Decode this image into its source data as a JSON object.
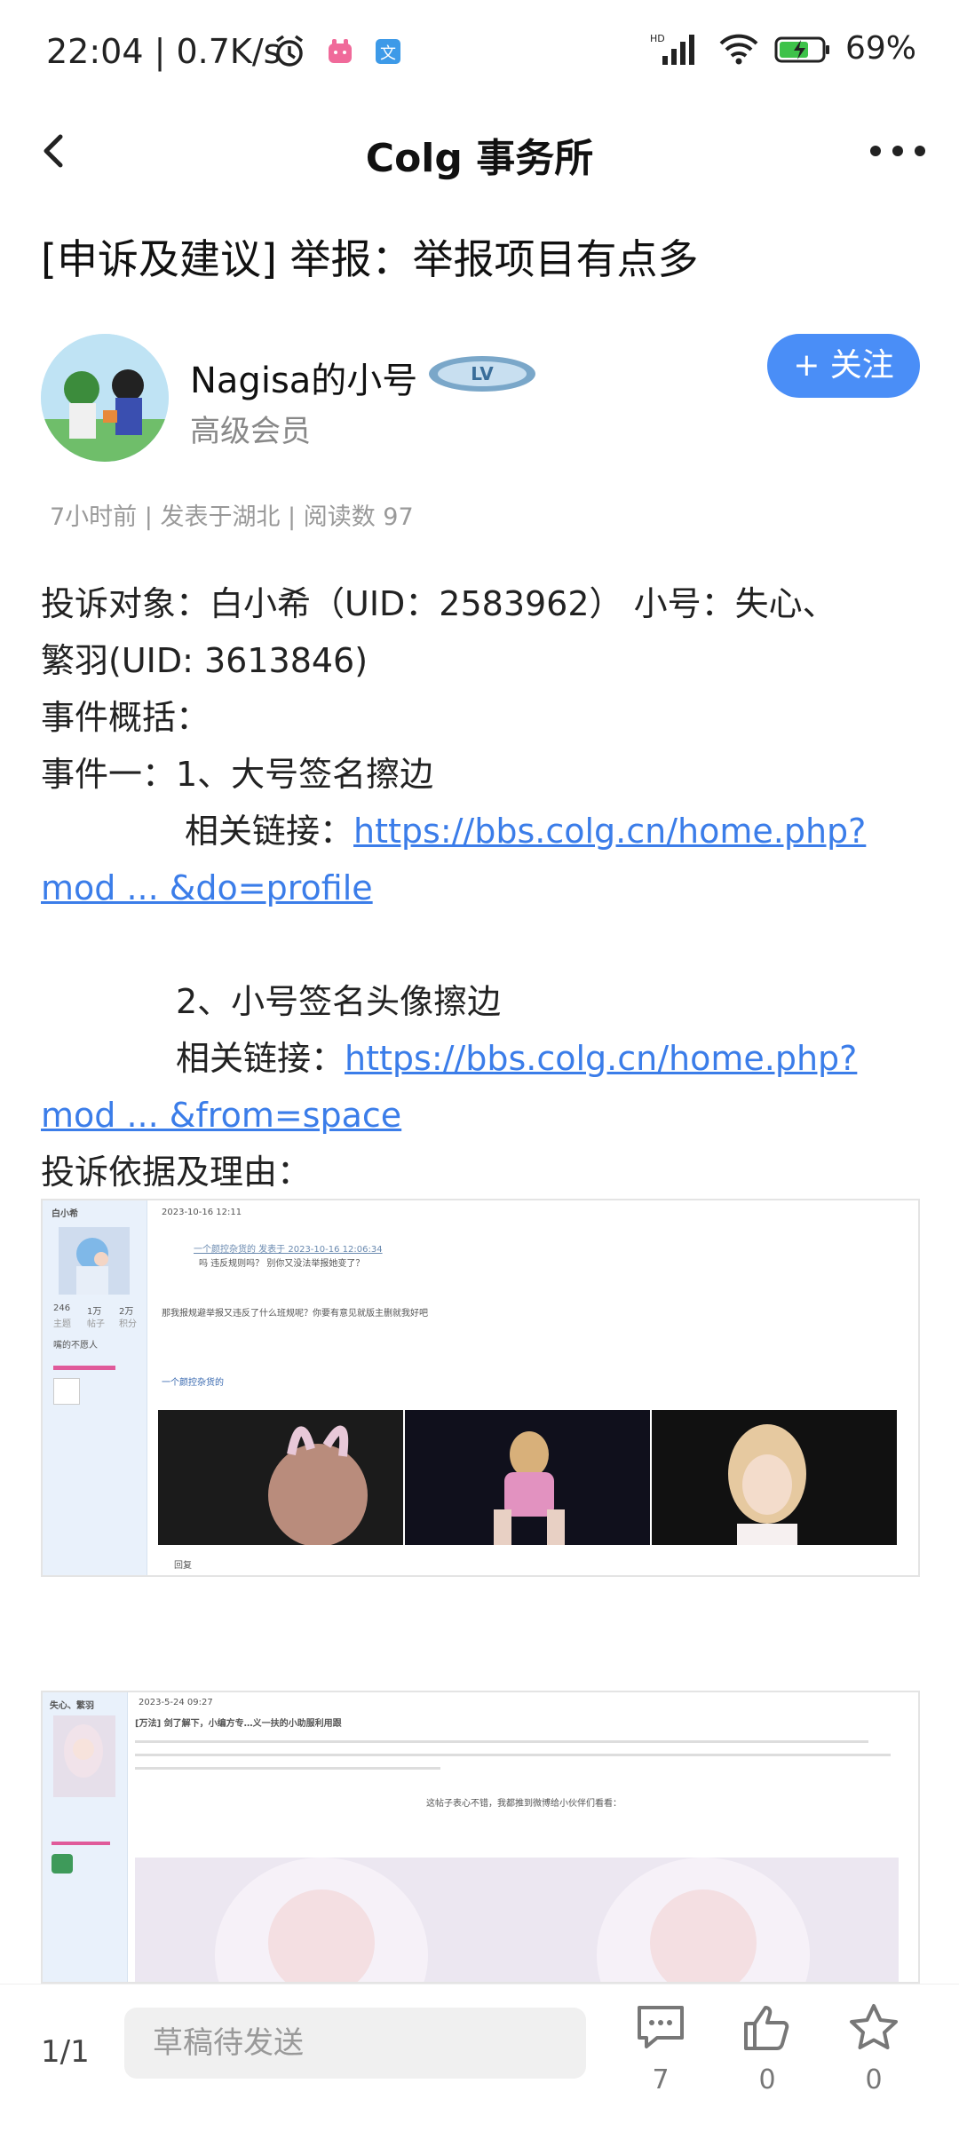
{
  "status_bar": {
    "time": "22:04",
    "speed": "0.7K/s",
    "network": "HD",
    "battery": "69%"
  },
  "nav": {
    "title": "Colg 事务所"
  },
  "post": {
    "title": "[申诉及建议] 举报：举报项目有点多",
    "author_name": "Nagisa的小号",
    "author_level": "高级会员",
    "follow_label": "+ 关注",
    "meta": "7小时前 | 发表于湖北 | 阅读数 97"
  },
  "content": {
    "l1": "投诉对象：白小希（UID：2583962）   小号：失心、",
    "l2": "繁羽(UID: 3613846)",
    "l3": "事件概括：",
    "l4": "事件一：1、大号签名擦边",
    "l5_prefix": "相关链接：",
    "l5_link": "https://bbs.colg.cn/home.php?",
    "l6_link": "mod ... &do=profile",
    "l7": "2、小号签名头像擦边",
    "l8_prefix": "相关链接：",
    "l8_link": "https://bbs.colg.cn/home.php?",
    "l9_link": "mod ... &from=space",
    "l10": "投诉依据及理由："
  },
  "screenshot1": {
    "username": "白小希",
    "date": "2023-10-16 12:11",
    "quote": "一个颜控杂货的 发表于 2023-10-16 12:06:34",
    "quote_body": "吗  违反规则吗？    别你又没法举报她变了？",
    "body": "那我报规避举报又违反了什么班规呢？你要有意见就版主删就我好吧",
    "poster": "一个颜控杂货的",
    "reply": "回复",
    "stats": [
      "246",
      "1万",
      "2万"
    ],
    "stat_labels": [
      "主题",
      "帖子",
      "积分"
    ],
    "rank": "嘴的不愿人"
  },
  "screenshot2": {
    "username": "失心、繁羽",
    "title": "[万法] 剑了解下，小编方专…义一扶的小助服利用跟",
    "date": "2023-5-24 09:27",
    "share": "这帖子表心不错，我都推到微博给小伙伴们看看："
  },
  "bottom": {
    "page": "1/1",
    "draft_placeholder": "草稿待发送",
    "comments": "7",
    "likes": "0",
    "favorites": "0"
  }
}
